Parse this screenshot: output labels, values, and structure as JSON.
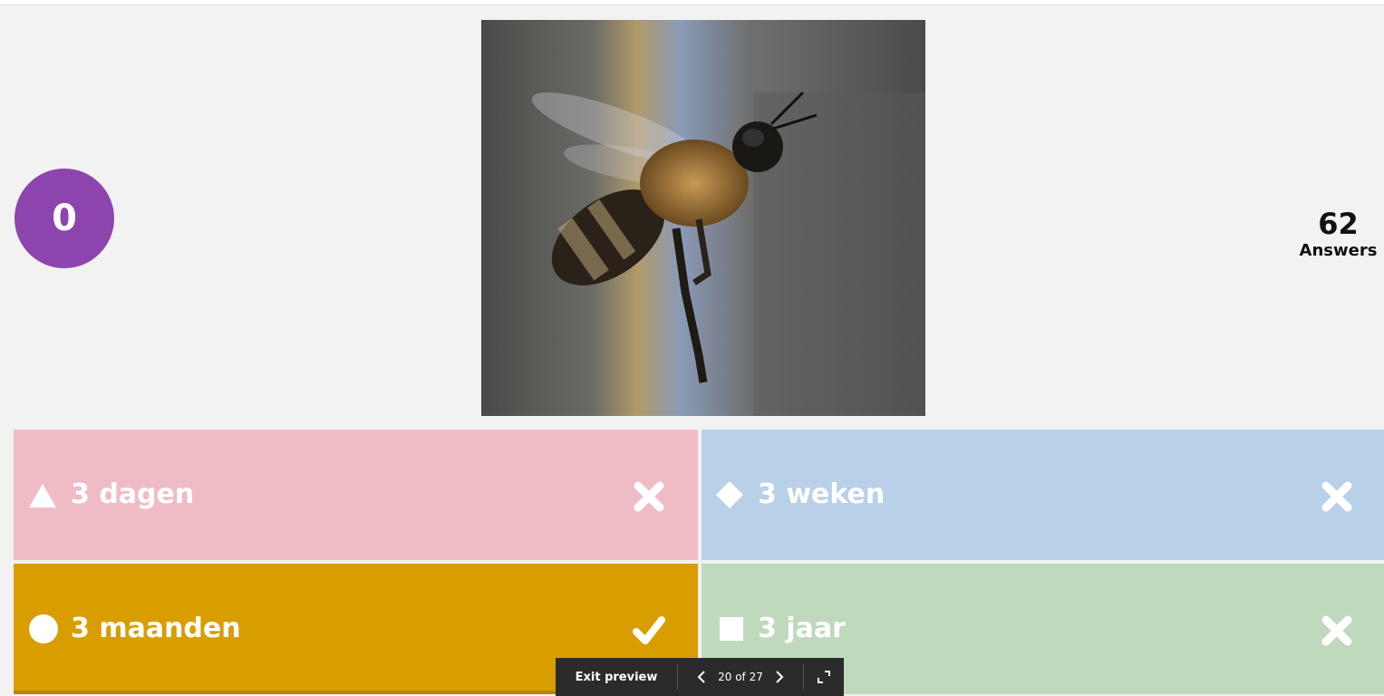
{
  "colors": {
    "timer": "#8e44ad",
    "red": "#efbcc6",
    "blue": "#b9d0e9",
    "yellow": "#d89e00",
    "green": "#bfd9bd"
  },
  "timer": {
    "value": "0"
  },
  "image": {
    "icon": "bee-photo"
  },
  "answers": {
    "count": "62",
    "label": "Answers"
  },
  "options": [
    {
      "shape": "triangle-icon",
      "label": "3 dagen",
      "status": "close-icon",
      "correct": false
    },
    {
      "shape": "diamond-icon",
      "label": "3 weken",
      "status": "close-icon",
      "correct": false
    },
    {
      "shape": "circle-icon",
      "label": "3 maanden",
      "status": "check-icon",
      "correct": true
    },
    {
      "shape": "square-icon",
      "label": "3 jaar",
      "status": "close-icon",
      "correct": false
    }
  ],
  "preview_bar": {
    "exit_label": "Exit preview",
    "counter": "20 of 27"
  }
}
